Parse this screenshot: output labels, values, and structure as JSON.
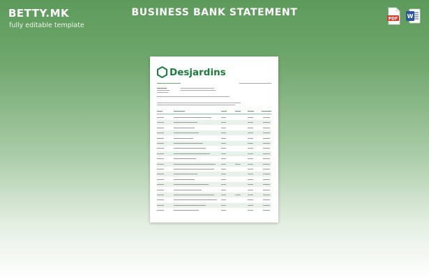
{
  "brand": {
    "name": "BETTY.MK",
    "tagline": "fully editable template"
  },
  "header": {
    "title": "BUSINESS BANK STATEMENT"
  },
  "formats": [
    {
      "name": "pdf-icon",
      "label": "PDF",
      "color": "#d93a2f"
    },
    {
      "name": "word-icon",
      "label": "W",
      "color": "#2b579a"
    }
  ],
  "document": {
    "bank_name": "Desjardins",
    "bank_color": "#1a7d3c",
    "row_count": 19
  }
}
